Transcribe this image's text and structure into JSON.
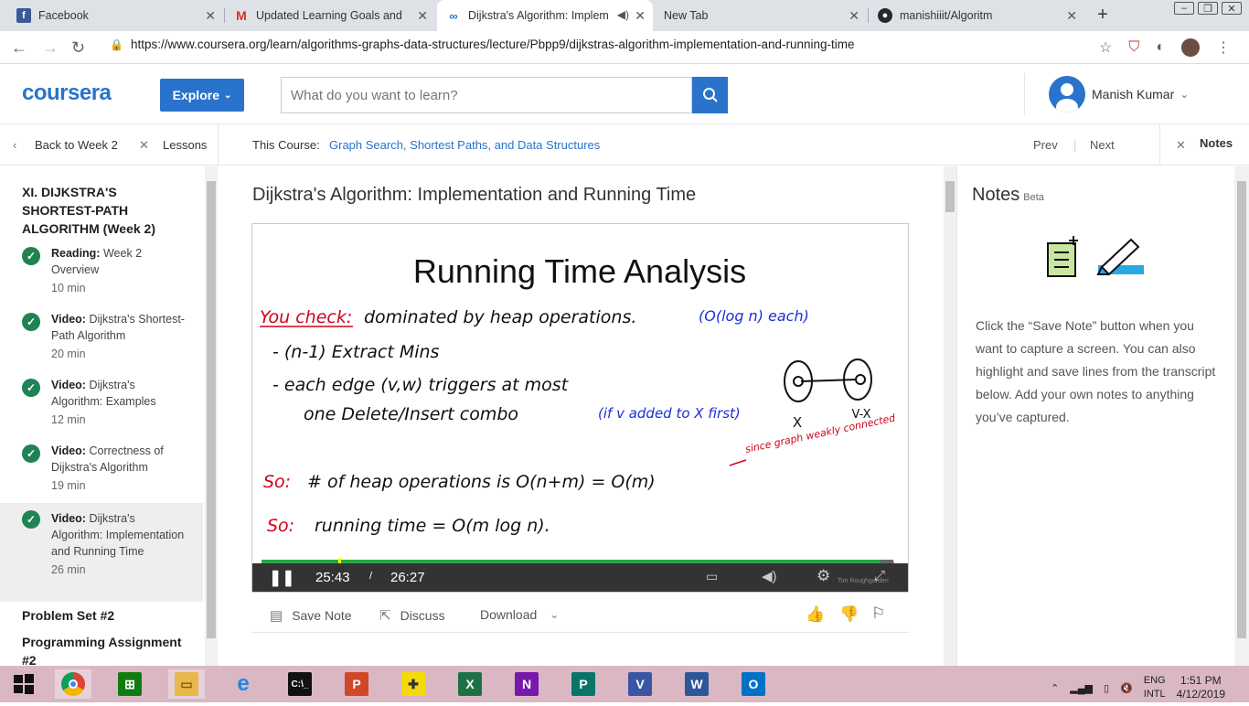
{
  "browser": {
    "tabs": [
      {
        "title": "Facebook",
        "icon": "facebook-icon",
        "color": "#3b5998"
      },
      {
        "title": "Updated Learning Goals and Tin",
        "icon": "gmail-icon",
        "color": "#d93025"
      },
      {
        "title": "Dijkstra's Algorithm: Implem",
        "icon": "coursera-icon",
        "color": "#2a73cc",
        "active": true
      },
      {
        "title": "New Tab",
        "icon": "",
        "color": ""
      },
      {
        "title": "manishiiit/Algoritm",
        "icon": "github-icon",
        "color": "#24292e"
      }
    ],
    "url": "https://www.coursera.org/learn/algorithms-graphs-data-structures/lecture/Pbpp9/dijkstras-algorithm-implementation-and-running-time"
  },
  "header": {
    "logo": "coursera",
    "explore_label": "Explore",
    "search_placeholder": "What do you want to learn?",
    "user_name": "Manish Kumar"
  },
  "subnav": {
    "back_label": "Back to Week 2",
    "lessons_label": "Lessons",
    "course_prefix": "This Course:",
    "course_name": "Graph Search, Shortest Paths, and Data Structures",
    "prev_label": "Prev",
    "next_label": "Next",
    "notes_label": "Notes"
  },
  "sidebar": {
    "week_title": "XI. DIJKSTRA'S SHORTEST-PATH ALGORITHM (Week 2)",
    "lessons": [
      {
        "kind": "Reading:",
        "title": "Week 2 Overview",
        "duration": "10 min"
      },
      {
        "kind": "Video:",
        "title": "Dijkstra's Shortest-Path Algorithm",
        "duration": "20 min"
      },
      {
        "kind": "Video:",
        "title": "Dijkstra's Algorithm: Examples",
        "duration": "12 min"
      },
      {
        "kind": "Video:",
        "title": "Correctness of Dijkstra's Algorithm",
        "duration": "19 min"
      },
      {
        "kind": "Video:",
        "title": "Dijkstra's Algorithm: Implementation and Running Time",
        "duration": "26 min",
        "active": true
      }
    ],
    "sections": [
      "Problem Set #2",
      "Programming Assignment #2"
    ]
  },
  "main": {
    "lecture_title": "Dijkstra's Algorithm: Implementation and Running Time",
    "slide": {
      "title": "Running Time Analysis",
      "line1_red": "You check:",
      "line1": "dominated by heap operations.",
      "line1_blue": "(O(log n) each)",
      "line2": "- (n-1) Extract Mins",
      "line3": "- each edge (v,w) triggers at most",
      "line4": "one Delete/Insert combo",
      "line4_blue": "(if v added to X first)",
      "line5_red": "So:",
      "line5": "# of heap operations is O(n+m) = O(m)",
      "line5_note": "since graph weakly connected",
      "line6_red": "So:",
      "line6": "running time = O(m log n).",
      "graph_x_label": "X",
      "graph_vx_label": "V-X",
      "credit": "Tim Roughgarden"
    },
    "player": {
      "current_time": "25:43",
      "separator": "/",
      "total_time": "26:27",
      "progress": 0.97
    },
    "actions": {
      "save_note": "Save Note",
      "discuss": "Discuss",
      "download": "Download"
    }
  },
  "notes": {
    "title": "Notes",
    "beta": "Beta",
    "description": "Click the “Save Note” button when you want to capture a screen. You can also highlight and save lines from the transcript below. Add your own notes to anything you’ve captured."
  },
  "taskbar": {
    "lang_top": "ENG",
    "lang_bottom": "INTL",
    "time": "1:51 PM",
    "date": "4/12/2019"
  }
}
